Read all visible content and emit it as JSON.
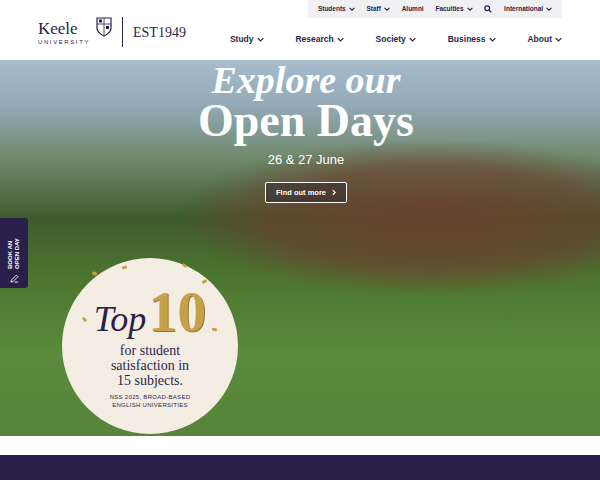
{
  "logo": {
    "name": "Keele",
    "subtitle": "UNIVERSITY",
    "established": "EST1949"
  },
  "utility_nav": [
    {
      "label": "Students",
      "kind": "dropdown"
    },
    {
      "label": "Staff",
      "kind": "dropdown"
    },
    {
      "label": "Alumni",
      "kind": "link"
    },
    {
      "label": "Faculties",
      "kind": "dropdown"
    },
    {
      "label": "",
      "kind": "search"
    },
    {
      "label": "International",
      "kind": "dropdown"
    }
  ],
  "main_nav": [
    {
      "label": "Study",
      "kind": "dropdown"
    },
    {
      "label": "Research",
      "kind": "dropdown"
    },
    {
      "label": "Society",
      "kind": "dropdown"
    },
    {
      "label": "Business",
      "kind": "dropdown"
    },
    {
      "label": "About",
      "kind": "dropdown"
    }
  ],
  "hero": {
    "title_lines": [
      "Explore our",
      "Open Days"
    ],
    "date": "26 & 27 June",
    "button": "Find out more"
  },
  "side_tab": {
    "label": "BOOK AN OPEN DAY"
  },
  "badge": {
    "top": "Top",
    "number": "10",
    "lines": [
      "for student",
      "satisfaction in",
      "15 subjects."
    ],
    "source_lines": [
      "NSS 2025, BROAD-BASED",
      "ENGLISH UNIVERSITIES"
    ]
  }
}
